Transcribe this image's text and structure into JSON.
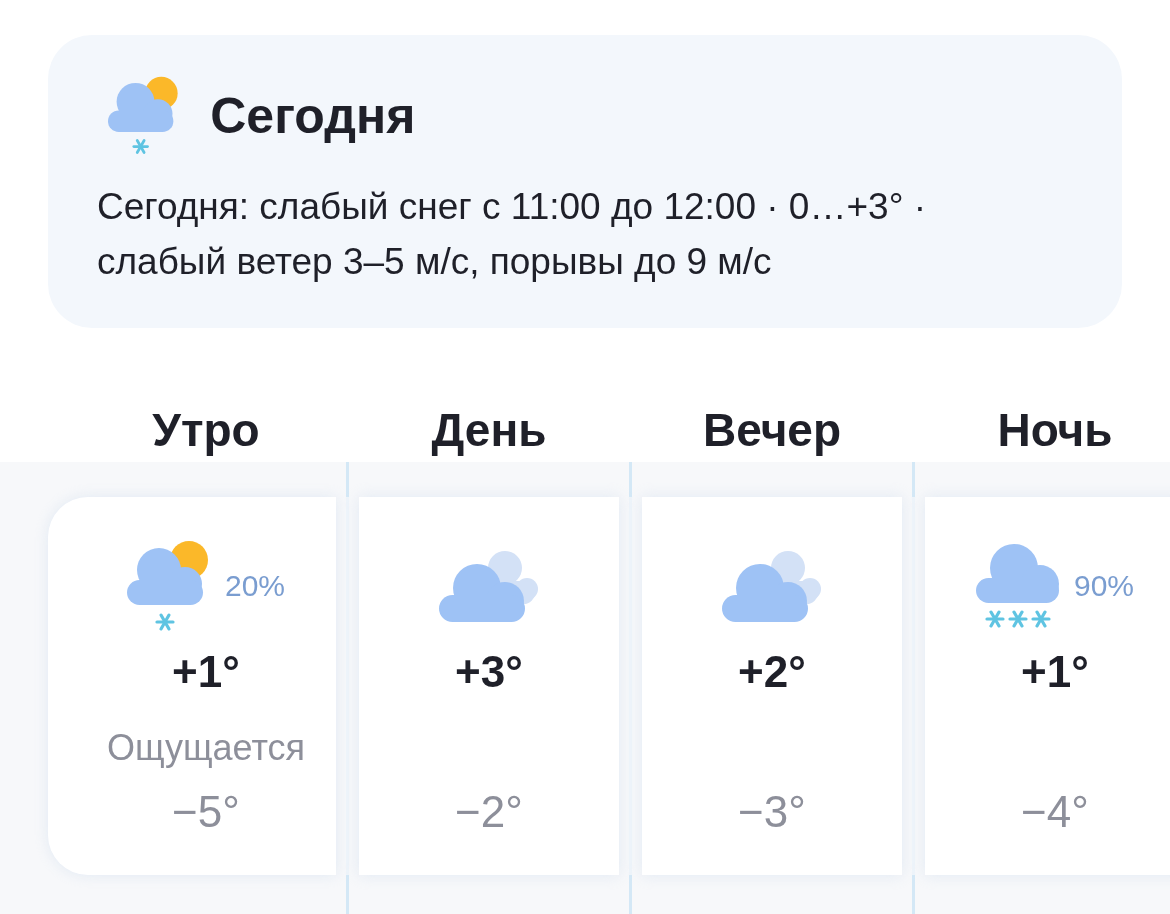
{
  "summary": {
    "kind": "partly-cloudy-snow",
    "title": "Сегодня",
    "description": "Сегодня: слабый снег с 11:00 до 12:00 · 0…+3° · слабый ветер 3–5 м/с, порывы до 9 м/с"
  },
  "periods": [
    {
      "name": "Утро",
      "kind": "partly-cloudy-snow",
      "precipitation": "20%",
      "temperature": "+1°",
      "feels_like_label": "Ощущается",
      "feels_like": "−5°"
    },
    {
      "name": "День",
      "kind": "cloudy",
      "temperature": "+3°",
      "feels_like": "−2°"
    },
    {
      "name": "Вечер",
      "kind": "cloudy",
      "temperature": "+2°",
      "feels_like": "−3°"
    },
    {
      "name": "Ночь",
      "kind": "snow",
      "precipitation": "90%",
      "temperature": "+1°",
      "feels_like": "−4°"
    }
  ]
}
